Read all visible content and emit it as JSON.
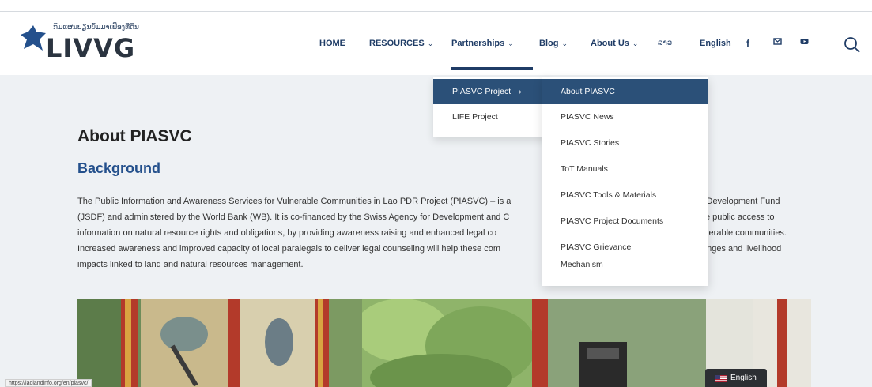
{
  "logo": {
    "lao_text": "ກົມແຜນປຽນບົ້ມມາເຟື່ອງທີ່ດິນ",
    "text": "LIVVG"
  },
  "nav": {
    "home": "HOME",
    "resources": "RESOURCES",
    "partnerships": "Partnerships",
    "blog": "Blog",
    "about_us": "About Us",
    "lao": "ລາວ",
    "english": "English",
    "social": [
      "facebook-icon",
      "email-icon",
      "youtube-icon"
    ]
  },
  "dropdown_partnerships": {
    "items": [
      "PIASVC Project",
      "LIFE Project"
    ],
    "active": "PIASVC Project"
  },
  "dropdown_piasvc": {
    "items": [
      "About PIASVC",
      "PIASVC News",
      "PIASVC Stories",
      "ToT Manuals",
      "PIASVC Tools & Materials",
      "PIASVC Project Documents",
      "PIASVC Grievance",
      "Mechanism"
    ],
    "active": "About PIASVC"
  },
  "main": {
    "title": "About PIASVC",
    "section_heading": "Background",
    "paragraph_lines": [
      "The Public Information and Awareness Services for Vulnerable Communities in Lao PDR Project (PIASVC) – is a",
      "(JSDF) and administered by the World Bank (WB). It is co-financed by the Swiss Agency for Development and C",
      "information on natural resource rights and obligations, by providing awareness raising and enhanced legal co",
      "Increased awareness and improved capacity of local paralegals to deliver legal counseling will help these com",
      "impacts linked to land and natural resources management."
    ],
    "paragraph_right_fragments": [
      "l Development Fund",
      "e public access to",
      "lnerable communities.",
      "enges and livelihood"
    ]
  },
  "status_bar": {
    "url": "https://laolandinfo.org/en/piasvc/"
  },
  "language_widget": {
    "label": "English"
  },
  "colors": {
    "brand_blue": "#1f3c66",
    "active_menu": "#2b5078",
    "heading_blue": "#24508c"
  }
}
